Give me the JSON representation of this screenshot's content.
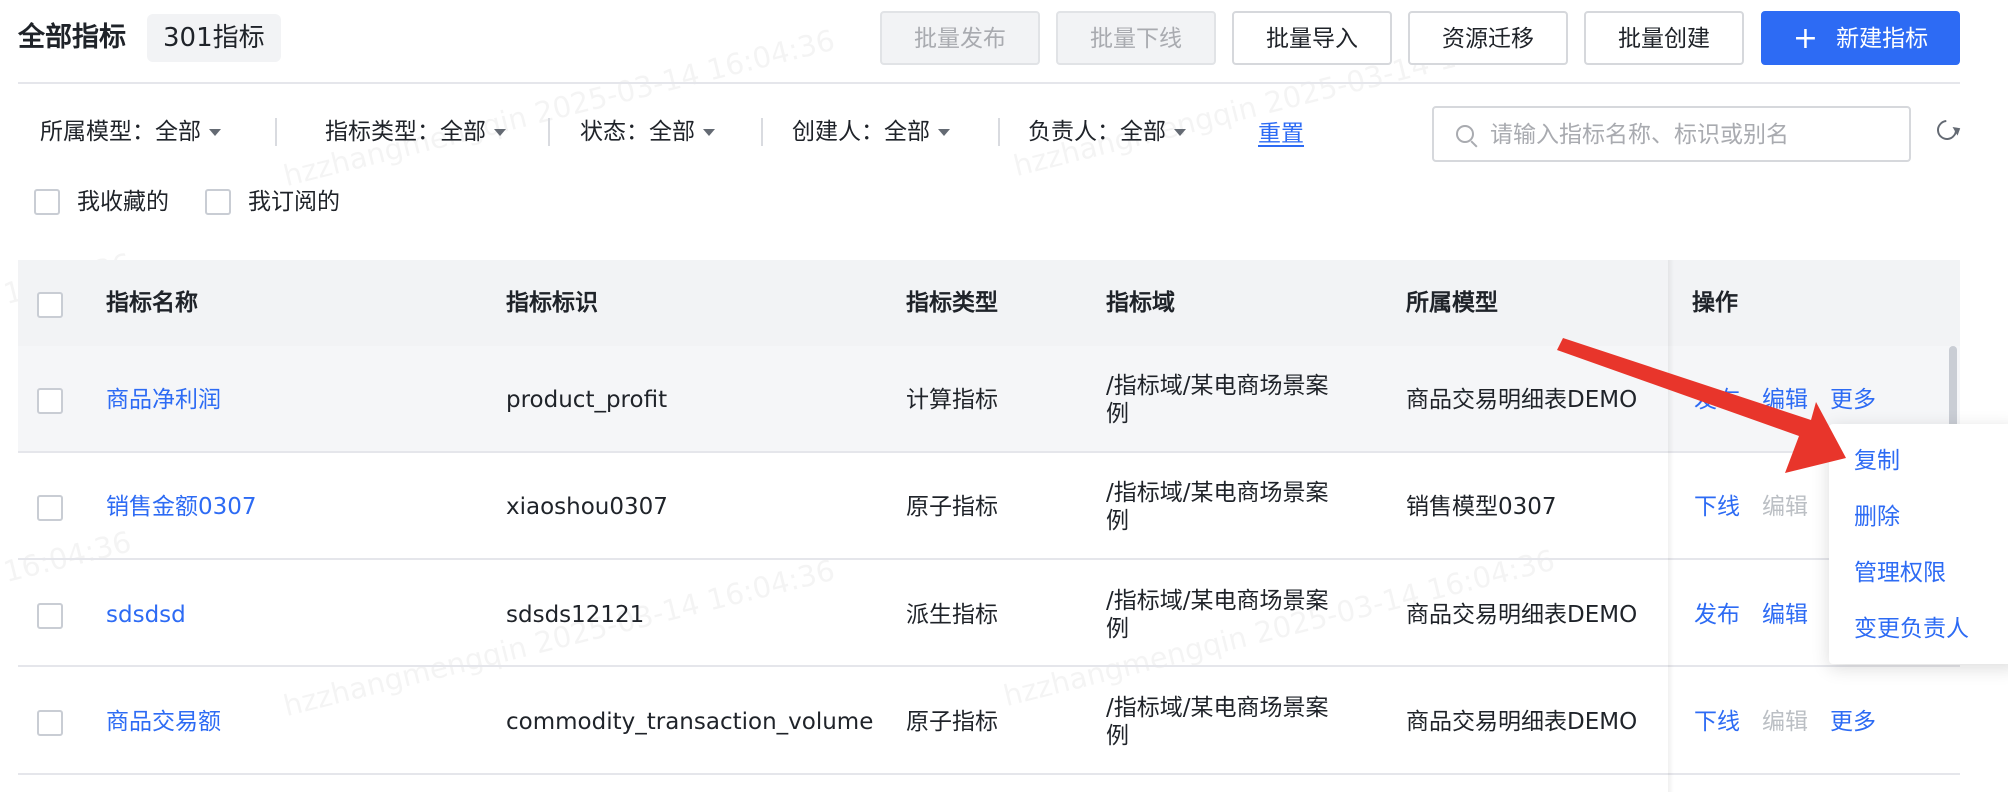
{
  "header": {
    "title": "全部指标",
    "count": "301指标",
    "buttons": {
      "batch_publish": "批量发布",
      "batch_offline": "批量下线",
      "batch_import": "批量导入",
      "migrate": "资源迁移",
      "batch_create": "批量创建",
      "new_metric": "新建指标"
    }
  },
  "filters": {
    "model": "所属模型：全部",
    "metric_type": "指标类型：全部",
    "status": "状态：全部",
    "creator": "创建人：全部",
    "owner": "负责人：全部",
    "reset": "重置",
    "search_placeholder": "请输入指标名称、标识或别名",
    "favorites": "我收藏的",
    "subscribed": "我订阅的"
  },
  "table": {
    "columns": [
      "指标名称",
      "指标标识",
      "指标类型",
      "指标域",
      "所属模型",
      "操作"
    ],
    "rows": [
      {
        "name": "商品净利润",
        "id": "product_profit",
        "type": "计算指标",
        "domain_l1": "/指标域/某电商场景案",
        "domain_l2": "例",
        "model": "商品交易明细表DEMO",
        "op1": "发布",
        "op2": "编辑",
        "op3": "更多"
      },
      {
        "name": "销售金额0307",
        "id": "xiaoshou0307",
        "type": "原子指标",
        "domain_l1": "/指标域/某电商场景案",
        "domain_l2": "例",
        "model": "销售模型0307",
        "op1": "下线",
        "op2": "编辑",
        "op3": ""
      },
      {
        "name": "sdsdsd",
        "id": "sdsds12121",
        "type": "派生指标",
        "domain_l1": "/指标域/某电商场景案",
        "domain_l2": "例",
        "model": "商品交易明细表DEMO",
        "op1": "发布",
        "op2": "编辑",
        "op3": ""
      },
      {
        "name": "商品交易额",
        "id": "commodity_transaction_volume",
        "type": "原子指标",
        "domain_l1": "/指标域/某电商场景案",
        "domain_l2": "例",
        "model": "商品交易明细表DEMO",
        "op1": "下线",
        "op2": "编辑",
        "op3": "更多"
      }
    ]
  },
  "dropdown": {
    "items": [
      "复制",
      "删除",
      "管理权限",
      "变更负责人"
    ]
  },
  "watermark": {
    "user": "hzzhangmengqin",
    "time": "2025-03-14 16:04:36",
    "fragment": "16:04:36"
  },
  "colors": {
    "primary": "#2d6bf4",
    "arrow": "#e8352b"
  }
}
